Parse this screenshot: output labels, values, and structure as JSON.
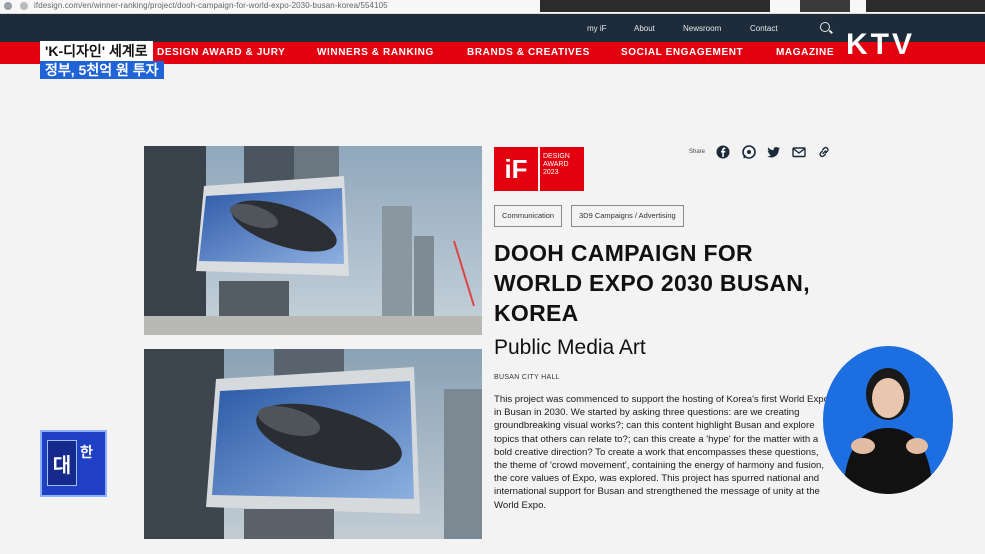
{
  "browser": {
    "url": "ifdesign.com/en/winner-ranking/project/dooh-campaign-for-world-expo-2030-busan-korea/554105"
  },
  "topnav": {
    "my_if": "my iF",
    "about": "About",
    "newsroom": "Newsroom",
    "contact": "Contact"
  },
  "mainnav": {
    "design_award": "DESIGN AWARD & JURY",
    "winners": "WINNERS & RANKING",
    "brands": "BRANDS & CREATIVES",
    "social": "SOCIAL ENGAGEMENT",
    "magazine": "MAGAZINE"
  },
  "broadcast": {
    "caption_line1": "'K-디자인' 세계로",
    "caption_line2": "정부, 5천억 원 투자",
    "channel_logo": "KTV",
    "badge_main": "대",
    "badge_side": "한"
  },
  "award": {
    "logo_mark": "iF",
    "logo_line1": "DESIGN",
    "logo_line2": "AWARD",
    "logo_year": "2023"
  },
  "share": {
    "label": "Share"
  },
  "tags": [
    "Communication",
    "3D9 Campaigns / Advertising"
  ],
  "project": {
    "title": "DOOH CAMPAIGN FOR WORLD EXPO 2030 BUSAN, KOREA",
    "subtitle": "Public Media Art",
    "client": "BUSAN CITY HALL",
    "description": "This project was commenced to support the hosting of Korea's first World Expo in Busan in 2030. We started by asking three questions: are we creating groundbreaking visual works?; can this content highlight Busan and explore topics that others can relate to?; can this create a 'hype' for the matter with a bold creative direction? To create a work that encompasses these questions, the theme of 'crowd movement', containing the energy of harmony and fusion, the core values of Expo, was explored. This project has spurred national and international support for Busan and strengthened the message of unity at the World Expo."
  },
  "colors": {
    "brand_red": "#e3000f",
    "nav_dark": "#1d2b3a",
    "caption_blue": "#1f63d6"
  }
}
